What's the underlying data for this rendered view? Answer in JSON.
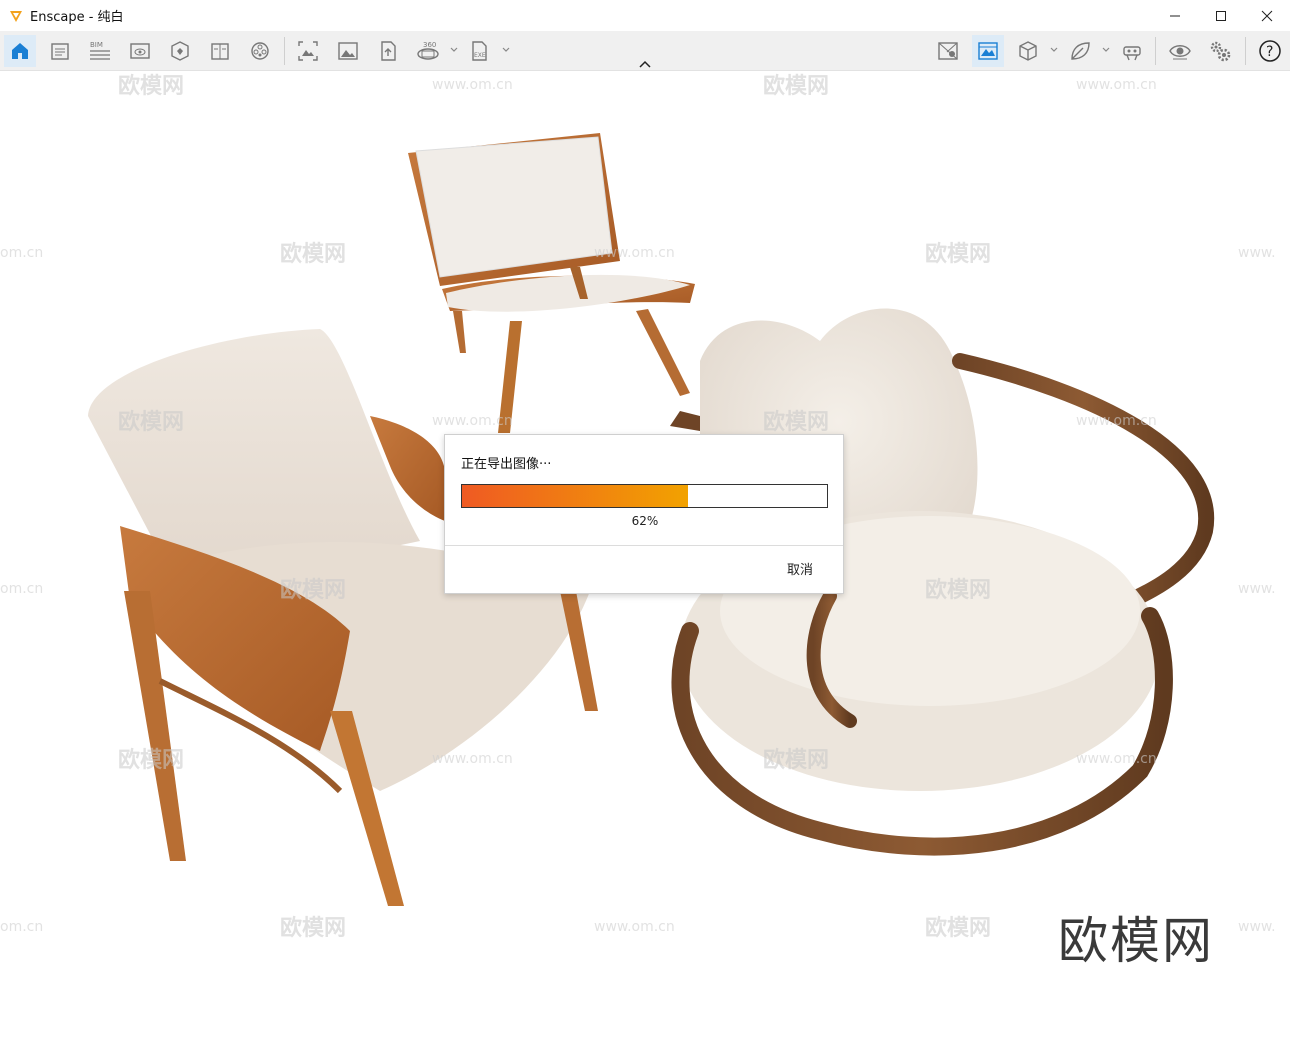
{
  "window": {
    "title": "Enscape - 纯白"
  },
  "toolbar": {
    "left_icons": [
      "home-icon",
      "document-icon",
      "bim-icon",
      "view-icon",
      "asset-icon",
      "book-icon",
      "video-icon"
    ],
    "capture_icons": [
      "screenshot-icon",
      "image-icon",
      "upload-icon",
      "panorama-360-icon",
      "exe-export-icon"
    ],
    "right_icons": [
      "map-icon",
      "visual-settings-icon",
      "cube-icon",
      "leaf-icon",
      "vr-headset-icon",
      "eye-icon",
      "settings-icon",
      "help-icon"
    ],
    "bim_label": "BIM",
    "pano_label": "360",
    "exe_label": "EXE",
    "help_label": "?"
  },
  "dialog": {
    "message": "正在导出图像···",
    "progress_percent": 62,
    "progress_label": "62%",
    "cancel_label": "取消"
  },
  "watermarks": {
    "brand_text": "欧模网",
    "url_text": "www.om.cn",
    "url_fragment": "om.cn",
    "url_left_fragment": "www."
  },
  "colors": {
    "progress_start": "#ef5a23",
    "progress_end": "#f2a200",
    "active_button": "#ddebf7",
    "accent_blue": "#1a7fd4"
  }
}
